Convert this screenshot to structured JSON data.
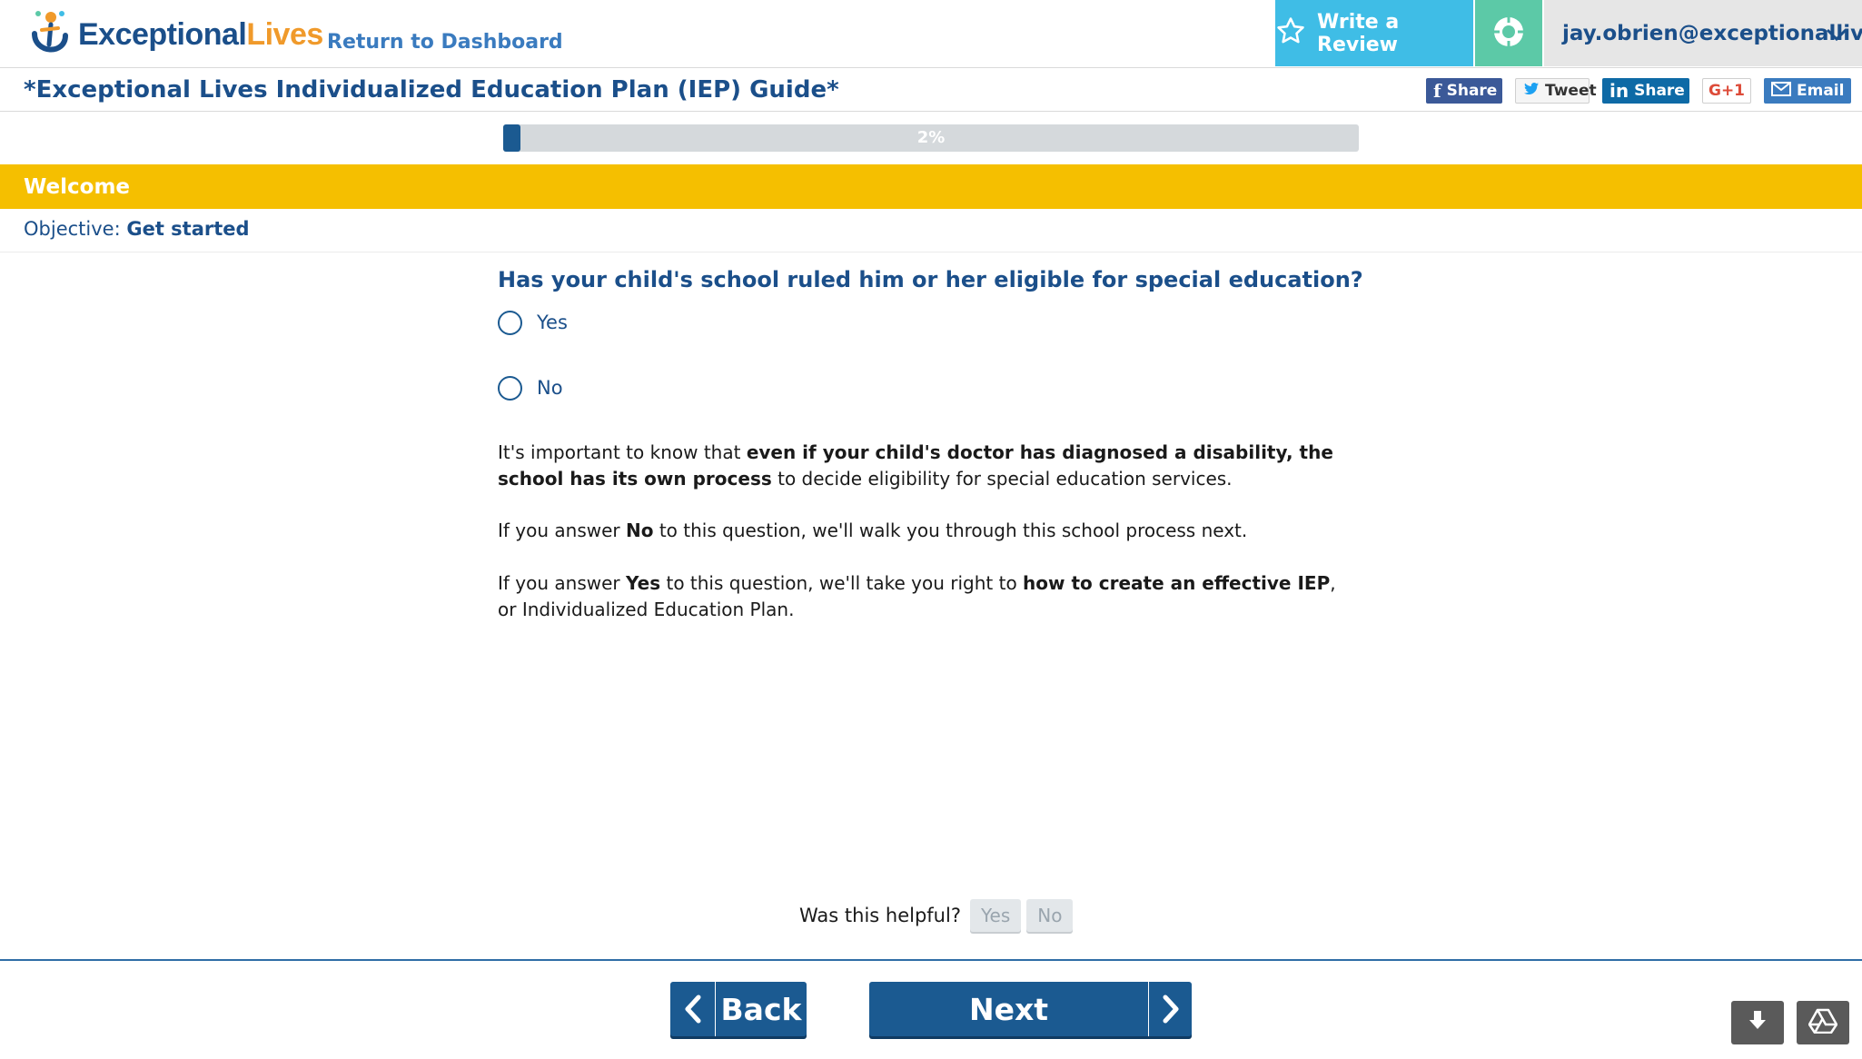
{
  "header": {
    "logo": {
      "part1": "Exceptional",
      "part2": "Lives"
    },
    "return_link": "Return to Dashboard",
    "write_review": "Write a Review",
    "user_email": "jay.obrien@exceptionallive"
  },
  "titlebar": {
    "title": "*Exceptional Lives Individualized Education Plan (IEP) Guide*",
    "shares": {
      "facebook": "Share",
      "twitter": "Tweet",
      "linkedin": "Share",
      "google": "G+1",
      "email": "Email"
    }
  },
  "progress": {
    "label": "2%",
    "value": 0.02
  },
  "section": {
    "title": "Welcome",
    "objective_label": "Objective:",
    "objective_value": "Get started"
  },
  "question": {
    "text": "Has your child's school ruled him or her eligible for special education?",
    "options": [
      "Yes",
      "No"
    ]
  },
  "info": {
    "p1_a": "It's important to know that ",
    "p1_b": "even if your child's doctor has diagnosed a disability, the school has its own process",
    "p1_c": " to decide eligibility for special education services.",
    "p2_a": "If you answer ",
    "p2_b": "No",
    "p2_c": " to this question, we'll walk you through this school process next.",
    "p3_a": "If you answer ",
    "p3_b": "Yes",
    "p3_c": " to this question, we'll take you right to ",
    "p3_d": "how to create an effective IEP",
    "p3_e": ",",
    "p3_f": "or Individualized Education Plan."
  },
  "feedback": {
    "label": "Was this helpful?",
    "yes": "Yes",
    "no": "No"
  },
  "nav": {
    "back": "Back",
    "next": "Next"
  },
  "colors": {
    "brand_blue": "#1b4f8a",
    "accent_orange": "#f09a2b",
    "section_yellow": "#f5bf00",
    "review_cyan": "#3fbde6",
    "target_green": "#5cc9a7"
  },
  "icons": {
    "review": "star-icon",
    "target": "crosshair-icon",
    "user_menu": "chevron-down-icon",
    "back": "chevron-left-icon",
    "next": "chevron-right-icon",
    "download": "download-icon",
    "drive": "google-drive-icon"
  }
}
